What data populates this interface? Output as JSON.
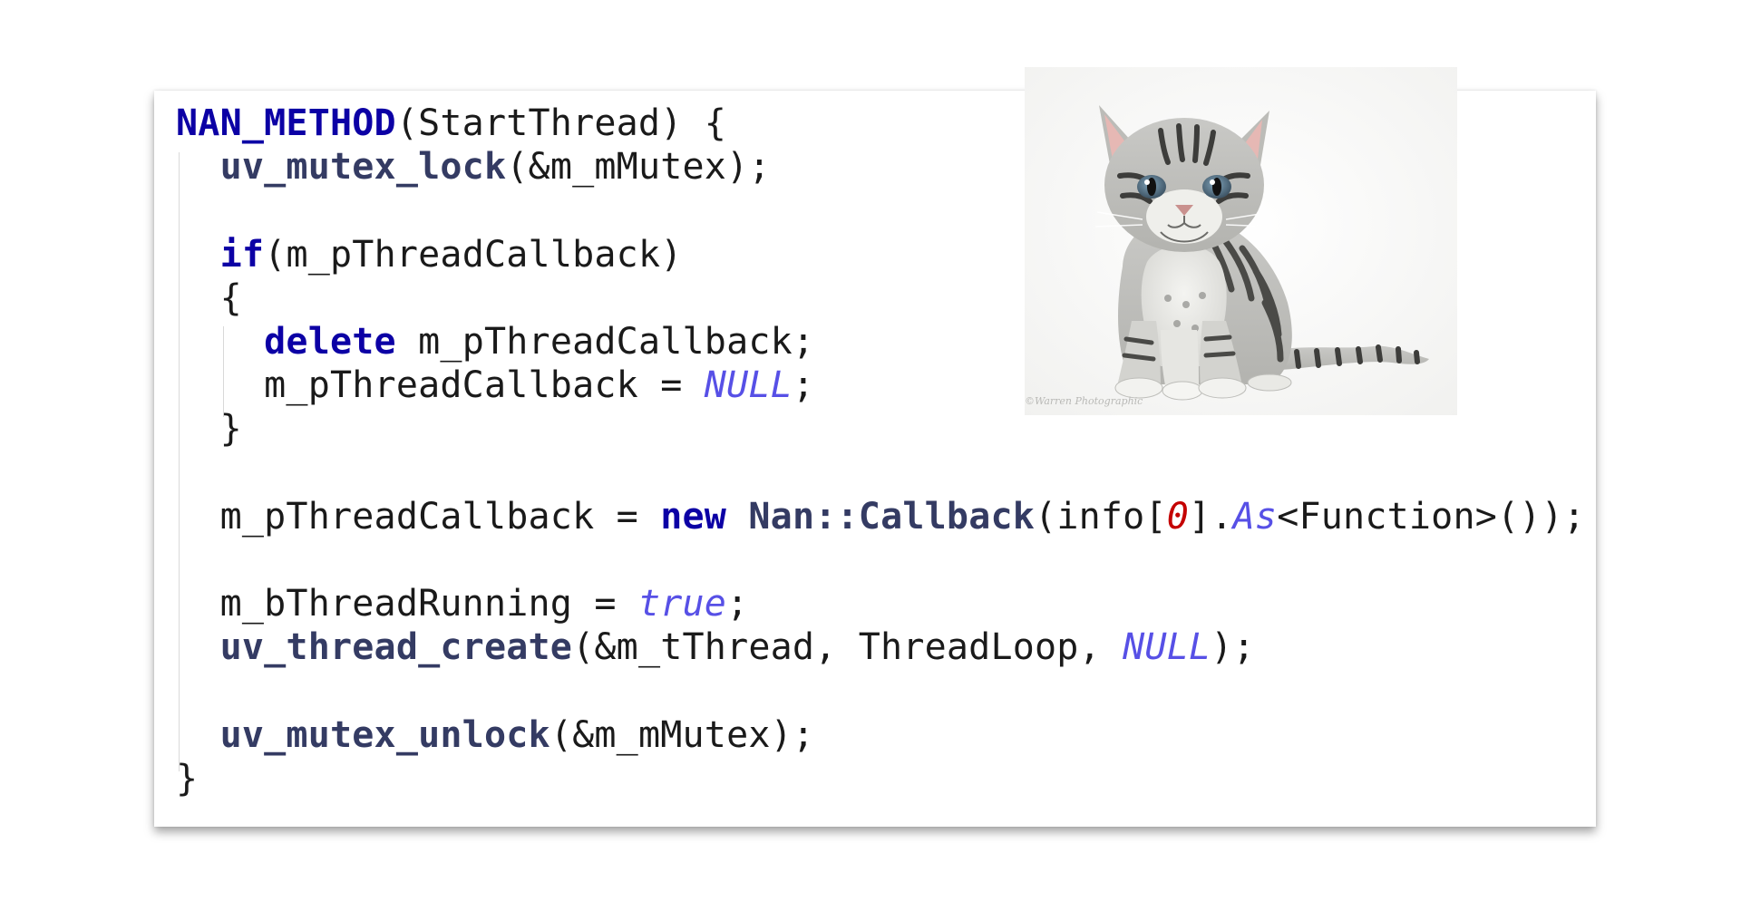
{
  "code": {
    "lines": [
      [
        {
          "t": "NAN_METHOD",
          "c": "kw"
        },
        {
          "t": "(StartThread) {",
          "c": ""
        }
      ],
      [
        {
          "t": "  ",
          "c": ""
        },
        {
          "t": "uv_mutex_lock",
          "c": "fn"
        },
        {
          "t": "(&m_mMutex);",
          "c": ""
        }
      ],
      [],
      [
        {
          "t": "  ",
          "c": ""
        },
        {
          "t": "if",
          "c": "kw"
        },
        {
          "t": "(m_pThreadCallback)",
          "c": ""
        }
      ],
      [
        {
          "t": "  {",
          "c": ""
        }
      ],
      [
        {
          "t": "    ",
          "c": ""
        },
        {
          "t": "delete",
          "c": "kw"
        },
        {
          "t": " m_pThreadCallback;",
          "c": ""
        }
      ],
      [
        {
          "t": "    m_pThreadCallback = ",
          "c": ""
        },
        {
          "t": "NULL",
          "c": "const"
        },
        {
          "t": ";",
          "c": ""
        }
      ],
      [
        {
          "t": "  }",
          "c": ""
        }
      ],
      [],
      [
        {
          "t": "  m_pThreadCallback = ",
          "c": ""
        },
        {
          "t": "new",
          "c": "kw"
        },
        {
          "t": " ",
          "c": ""
        },
        {
          "t": "Nan::Callback",
          "c": "fn"
        },
        {
          "t": "(info[",
          "c": ""
        },
        {
          "t": "0",
          "c": "num"
        },
        {
          "t": "].",
          "c": ""
        },
        {
          "t": "As",
          "c": "tpl"
        },
        {
          "t": "<Function>());",
          "c": ""
        }
      ],
      [],
      [
        {
          "t": "  m_bThreadRunning = ",
          "c": ""
        },
        {
          "t": "true",
          "c": "const"
        },
        {
          "t": ";",
          "c": ""
        }
      ],
      [
        {
          "t": "  ",
          "c": ""
        },
        {
          "t": "uv_thread_create",
          "c": "fn"
        },
        {
          "t": "(&m_tThread, ThreadLoop, ",
          "c": ""
        },
        {
          "t": "NULL",
          "c": "const"
        },
        {
          "t": ");",
          "c": ""
        }
      ],
      [],
      [
        {
          "t": "  ",
          "c": ""
        },
        {
          "t": "uv_mutex_unlock",
          "c": "fn"
        },
        {
          "t": "(&m_mMutex);",
          "c": ""
        }
      ],
      [
        {
          "t": "}",
          "c": ""
        }
      ]
    ]
  },
  "image": {
    "subject": "kitten-photo",
    "watermark": "©Warren Photographic"
  },
  "colors": {
    "keyword": "#0c00a5",
    "function": "#343b63",
    "constant": "#5750e6",
    "number": "#c40000",
    "text": "#1a1a1a",
    "background": "#ffffff"
  }
}
